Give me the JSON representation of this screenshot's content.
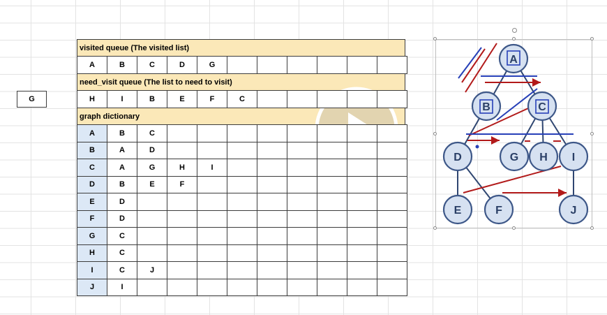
{
  "side_cell": "G",
  "visited": {
    "title": "visited queue (The visited list)",
    "items": [
      "A",
      "B",
      "C",
      "D",
      "G",
      "",
      "",
      "",
      "",
      "",
      ""
    ]
  },
  "need_visit": {
    "title": "need_visit queue (The list to need to visit)",
    "items": [
      "H",
      "I",
      "B",
      "E",
      "F",
      "C",
      "",
      "",
      "",
      "",
      ""
    ]
  },
  "graph_dict": {
    "title": "graph dictionary",
    "rows": [
      {
        "key": "A",
        "vals": [
          "B",
          "C",
          "",
          "",
          "",
          "",
          "",
          "",
          "",
          ""
        ]
      },
      {
        "key": "B",
        "vals": [
          "A",
          "D",
          "",
          "",
          "",
          "",
          "",
          "",
          "",
          ""
        ]
      },
      {
        "key": "C",
        "vals": [
          "A",
          "G",
          "H",
          "I",
          "",
          "",
          "",
          "",
          "",
          ""
        ]
      },
      {
        "key": "D",
        "vals": [
          "B",
          "E",
          "F",
          "",
          "",
          "",
          "",
          "",
          "",
          ""
        ]
      },
      {
        "key": "E",
        "vals": [
          "D",
          "",
          "",
          "",
          "",
          "",
          "",
          "",
          "",
          ""
        ]
      },
      {
        "key": "F",
        "vals": [
          "D",
          "",
          "",
          "",
          "",
          "",
          "",
          "",
          "",
          ""
        ]
      },
      {
        "key": "G",
        "vals": [
          "C",
          "",
          "",
          "",
          "",
          "",
          "",
          "",
          "",
          ""
        ]
      },
      {
        "key": "H",
        "vals": [
          "C",
          "",
          "",
          "",
          "",
          "",
          "",
          "",
          "",
          ""
        ]
      },
      {
        "key": "I",
        "vals": [
          "C",
          "J",
          "",
          "",
          "",
          "",
          "",
          "",
          "",
          ""
        ]
      },
      {
        "key": "J",
        "vals": [
          "I",
          "",
          "",
          "",
          "",
          "",
          "",
          "",
          "",
          ""
        ]
      }
    ]
  },
  "graph_nodes": [
    {
      "id": "A",
      "label": "A"
    },
    {
      "id": "B",
      "label": "B"
    },
    {
      "id": "C",
      "label": "C"
    },
    {
      "id": "D",
      "label": "D"
    },
    {
      "id": "G",
      "label": "G"
    },
    {
      "id": "H",
      "label": "H"
    },
    {
      "id": "I",
      "label": "I"
    },
    {
      "id": "E",
      "label": "E"
    },
    {
      "id": "F",
      "label": "F"
    },
    {
      "id": "J",
      "label": "J"
    }
  ],
  "colors": {
    "header_bg": "#fbe8b8",
    "key_bg": "#dce8f6",
    "queue_highlight": "#2b3fb8",
    "annotation_red": "#b21a1a",
    "annotation_blue": "#2740b8",
    "node_fill": "#d6e1f1",
    "node_stroke": "#3d5788"
  },
  "overlay": {
    "play_icon": "play-icon"
  }
}
